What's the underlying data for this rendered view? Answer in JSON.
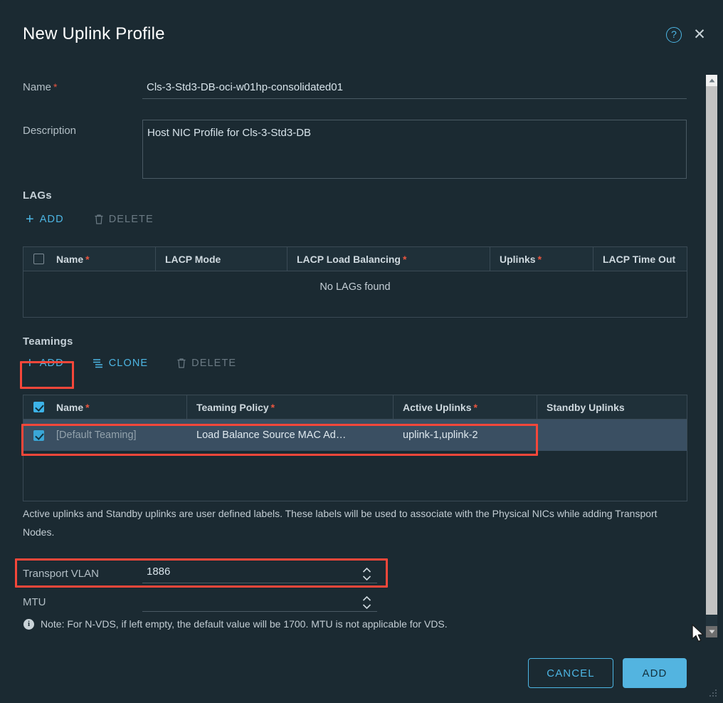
{
  "window": {
    "title": "New Uplink Profile",
    "help_icon": "help-circle-icon",
    "close_icon": "close-icon"
  },
  "form": {
    "name": {
      "label": "Name",
      "required": true,
      "value": "Cls-3-Std3-DB-oci-w01hp-consolidated01"
    },
    "description": {
      "label": "Description",
      "required": false,
      "value": "Host NIC Profile for Cls-3-Std3-DB"
    }
  },
  "lags": {
    "section_title": "LAGs",
    "toolbar": [
      {
        "label": "ADD",
        "icon": "plus-icon",
        "enabled": true
      },
      {
        "label": "DELETE",
        "icon": "trash-icon",
        "enabled": false
      }
    ],
    "columns": [
      {
        "label": "Name",
        "required": true
      },
      {
        "label": "LACP Mode",
        "required": false
      },
      {
        "label": "LACP Load Balancing",
        "required": true
      },
      {
        "label": "Uplinks",
        "required": true
      },
      {
        "label": "LACP Time Out",
        "required": false
      }
    ],
    "header_checkbox_checked": false,
    "empty_message": "No LAGs found",
    "rows": []
  },
  "teamings": {
    "section_title": "Teamings",
    "toolbar": [
      {
        "label": "ADD",
        "icon": "plus-icon",
        "enabled": true
      },
      {
        "label": "CLONE",
        "icon": "clone-icon",
        "enabled": true
      },
      {
        "label": "DELETE",
        "icon": "trash-icon",
        "enabled": false
      }
    ],
    "columns": [
      {
        "label": "Name",
        "required": true
      },
      {
        "label": "Teaming Policy",
        "required": true
      },
      {
        "label": "Active Uplinks",
        "required": true
      },
      {
        "label": "Standby Uplinks",
        "required": false
      }
    ],
    "header_checkbox_checked": true,
    "rows": [
      {
        "selected": true,
        "name": "[Default Teaming]",
        "teaming_policy": "Load Balance Source MAC Ad…",
        "active_uplinks": "uplink-1,uplink-2",
        "standby_uplinks": ""
      }
    ],
    "helper_text": "Active uplinks and Standby uplinks are user defined labels. These labels will be used to associate with the Physical NICs while adding Transport Nodes."
  },
  "transport_vlan": {
    "label": "Transport VLAN",
    "value": "1886",
    "spinner_icon": "stepper-arrows-icon"
  },
  "mtu": {
    "label": "MTU",
    "value": "",
    "spinner_icon": "stepper-arrows-icon"
  },
  "note": {
    "icon": "info-icon",
    "text": "Note: For N-VDS, if left empty, the default value will be 1700. MTU is not applicable for VDS."
  },
  "footer": {
    "cancel_label": "CANCEL",
    "add_label": "ADD"
  },
  "scrollbar": {
    "up_icon": "chevron-up-icon",
    "down_icon": "chevron-down-icon"
  },
  "colors": {
    "accent": "#4db6e4",
    "primary_button": "#53b4e0",
    "required_star": "#e8553f",
    "annotation": "#f6473a",
    "panel_bg": "#1b2a32",
    "row_selected": "#3a4f62"
  }
}
